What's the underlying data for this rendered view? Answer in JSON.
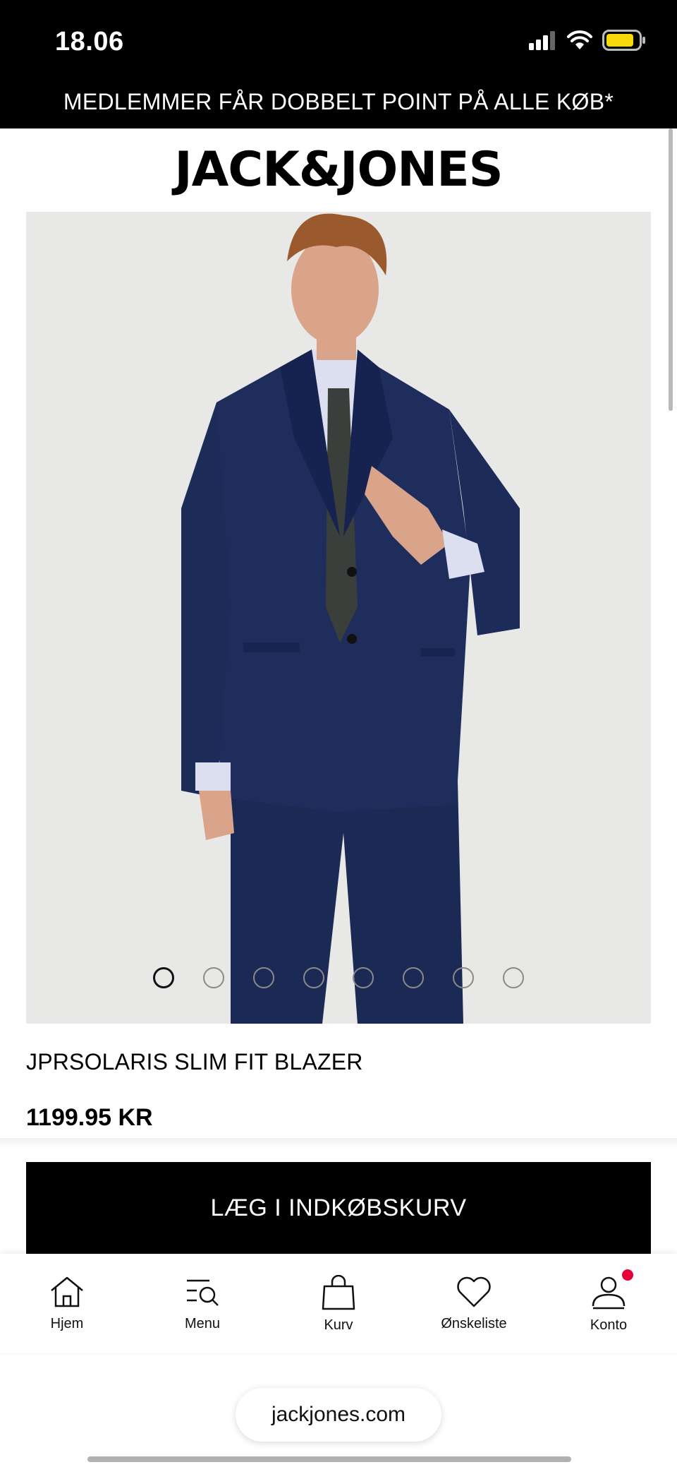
{
  "status_bar": {
    "time": "18.06",
    "battery_color": "#f5d90a"
  },
  "promo": {
    "text": "MEDLEMMER FÅR DOBBELT POINT PÅ ALLE KØB*"
  },
  "brand": {
    "name": "JACK&JONES"
  },
  "product": {
    "name": "JPRSOLARIS SLIM FIT BLAZER",
    "price": "1199.95 KR",
    "image_count": 8,
    "active_image": 1
  },
  "cart": {
    "button_label": "LÆG I INDKØBSKURV"
  },
  "bottom_nav": {
    "items": [
      {
        "label": "Hjem",
        "icon": "home-icon"
      },
      {
        "label": "Menu",
        "icon": "menu-search-icon"
      },
      {
        "label": "Kurv",
        "icon": "bag-icon"
      },
      {
        "label": "Ønskeliste",
        "icon": "heart-icon"
      },
      {
        "label": "Konto",
        "icon": "account-icon"
      }
    ]
  },
  "browser": {
    "url": "jackjones.com"
  },
  "colors": {
    "notification": "#e5003a",
    "background_image": "#e8e8e6",
    "suit": "#1b2a55"
  }
}
